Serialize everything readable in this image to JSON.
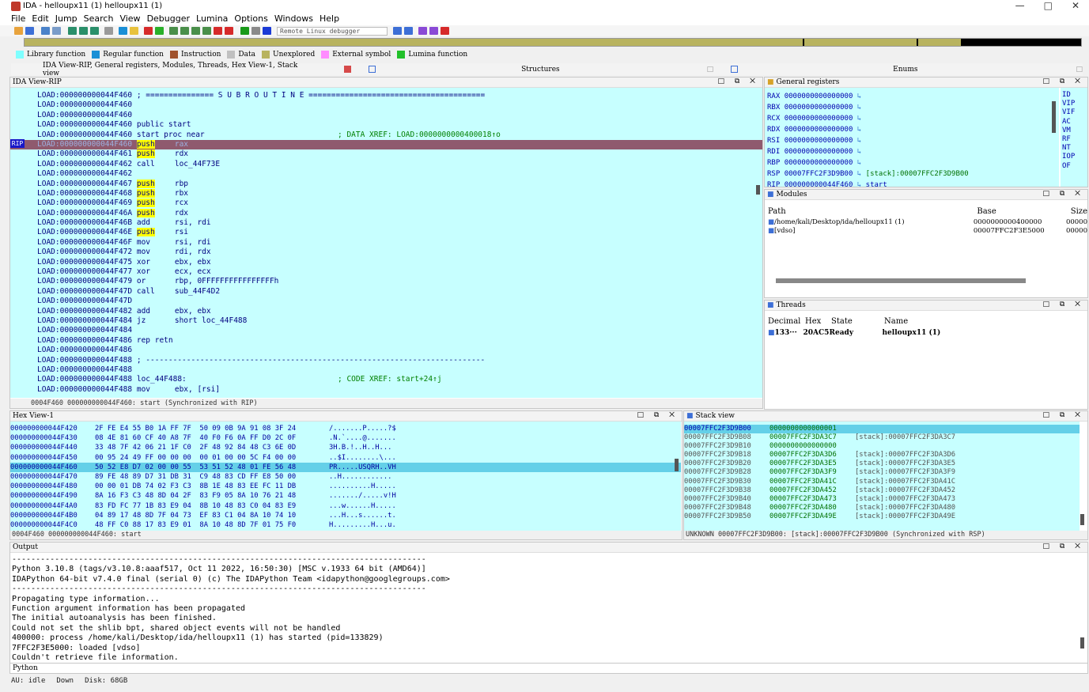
{
  "window": {
    "title": "IDA - helloupx11 (1) helloupx11 (1)",
    "minimize": "—",
    "maximize": "□",
    "close": "✕"
  },
  "menu": [
    "File",
    "Edit",
    "Jump",
    "Search",
    "View",
    "Debugger",
    "Lumina",
    "Options",
    "Windows",
    "Help"
  ],
  "toolbar": {
    "debugger_select": "Remote Linux debugger"
  },
  "legend": [
    {
      "label": "Library function",
      "color": "#7fffff"
    },
    {
      "label": "Regular function",
      "color": "#1a8fd6"
    },
    {
      "label": "Instruction",
      "color": "#a0522d"
    },
    {
      "label": "Data",
      "color": "#c0c0c0"
    },
    {
      "label": "Unexplored",
      "color": "#b8b35f"
    },
    {
      "label": "External symbol",
      "color": "#ff8cff"
    },
    {
      "label": "Lumina function",
      "color": "#22c02a"
    }
  ],
  "tabs": {
    "main": "IDA View-RIP, General registers, Modules, Threads, Hex View-1, Stack view",
    "structures": "Structures",
    "enums": "Enums"
  },
  "ida_view": {
    "title": "IDA View-RIP",
    "rip_label": "RIP",
    "lines": [
      {
        "addr": "LOAD:000000000044F460",
        "text": "; =============== S U B R O U T I N E =======================================",
        "hl": false
      },
      {
        "addr": "LOAD:000000000044F460",
        "text": "",
        "hl": false
      },
      {
        "addr": "LOAD:000000000044F460",
        "text": "",
        "hl": false
      },
      {
        "addr": "LOAD:000000000044F460",
        "text": "public start",
        "hl": false
      },
      {
        "addr": "LOAD:000000000044F460",
        "text": "start proc near",
        "cmt": "; DATA XREF: LOAD:0000000000400018↑o",
        "hl": false
      },
      {
        "addr": "LOAD:000000000044F460",
        "mn": "push",
        "op": "rax",
        "hl": true
      },
      {
        "addr": "LOAD:000000000044F461",
        "mn": "push",
        "op": "rdx",
        "hl": false
      },
      {
        "addr": "LOAD:000000000044F462",
        "mn": "call",
        "op": "loc_44F73E",
        "hl": false
      },
      {
        "addr": "LOAD:000000000044F462",
        "text": "",
        "hl": false
      },
      {
        "addr": "LOAD:000000000044F467",
        "mn": "push",
        "op": "rbp",
        "hl": false
      },
      {
        "addr": "LOAD:000000000044F468",
        "mn": "push",
        "op": "rbx",
        "hl": false
      },
      {
        "addr": "LOAD:000000000044F469",
        "mn": "push",
        "op": "rcx",
        "hl": false
      },
      {
        "addr": "LOAD:000000000044F46A",
        "mn": "push",
        "op": "rdx",
        "hl": false
      },
      {
        "addr": "LOAD:000000000044F46B",
        "mn": "add",
        "op": "rsi, rdi",
        "hl": false
      },
      {
        "addr": "LOAD:000000000044F46E",
        "mn": "push",
        "op": "rsi",
        "hl": false
      },
      {
        "addr": "LOAD:000000000044F46F",
        "mn": "mov",
        "op": "rsi, rdi",
        "hl": false
      },
      {
        "addr": "LOAD:000000000044F472",
        "mn": "mov",
        "op": "rdi, rdx",
        "hl": false
      },
      {
        "addr": "LOAD:000000000044F475",
        "mn": "xor",
        "op": "ebx, ebx",
        "hl": false
      },
      {
        "addr": "LOAD:000000000044F477",
        "mn": "xor",
        "op": "ecx, ecx",
        "hl": false
      },
      {
        "addr": "LOAD:000000000044F479",
        "mn": "or",
        "op": "rbp, 0FFFFFFFFFFFFFFFFh",
        "hl": false
      },
      {
        "addr": "LOAD:000000000044F47D",
        "mn": "call",
        "op": "sub_44F4D2",
        "hl": false
      },
      {
        "addr": "LOAD:000000000044F47D",
        "text": "",
        "hl": false
      },
      {
        "addr": "LOAD:000000000044F482",
        "mn": "add",
        "op": "ebx, ebx",
        "hl": false
      },
      {
        "addr": "LOAD:000000000044F484",
        "mn": "jz",
        "op": "short loc_44F488",
        "hl": false
      },
      {
        "addr": "LOAD:000000000044F484",
        "text": "",
        "hl": false
      },
      {
        "addr": "LOAD:000000000044F486",
        "mn": "rep retn",
        "op": "",
        "hl": false
      },
      {
        "addr": "LOAD:000000000044F486",
        "text": "",
        "hl": false
      },
      {
        "addr": "LOAD:000000000044F488",
        "text": "; ---------------------------------------------------------------------------",
        "hl": false
      },
      {
        "addr": "LOAD:000000000044F488",
        "text": "",
        "hl": false
      },
      {
        "addr": "LOAD:000000000044F488",
        "text": "loc_44F488:",
        "cmt": "; CODE XREF: start+24↑j",
        "hl": false
      },
      {
        "addr": "LOAD:000000000044F488",
        "mn": "mov",
        "op": "ebx, [rsi]",
        "hl": false
      }
    ],
    "status": "0004F460 000000000044F460: start (Synchronized with RIP)"
  },
  "registers": {
    "title": "General registers",
    "rows": [
      {
        "name": "RAX",
        "value": "0000000000000000",
        "extra": ""
      },
      {
        "name": "RBX",
        "value": "0000000000000000",
        "extra": ""
      },
      {
        "name": "RCX",
        "value": "0000000000000000",
        "extra": ""
      },
      {
        "name": "RDX",
        "value": "0000000000000000",
        "extra": ""
      },
      {
        "name": "RSI",
        "value": "0000000000000000",
        "extra": ""
      },
      {
        "name": "RDI",
        "value": "0000000000000000",
        "extra": ""
      },
      {
        "name": "RBP",
        "value": "0000000000000000",
        "extra": ""
      },
      {
        "name": "RSP",
        "value": "00007FFC2F3D9B00",
        "extra": "[stack]:00007FFC2F3D9B00"
      },
      {
        "name": "RIP",
        "value": "000000000044F460",
        "extra": "start"
      }
    ],
    "flags": [
      "ID",
      "VIP",
      "VIF",
      "AC",
      "VM",
      "RF",
      "NT",
      "IOP",
      "OF"
    ]
  },
  "modules": {
    "title": "Modules",
    "headers": [
      "Path",
      "Base",
      "Size"
    ],
    "rows": [
      {
        "path": "/home/kali/Desktop/ida/helloupx11 (1)",
        "base": "0000000000400000",
        "size": "00000"
      },
      {
        "path": "[vdso]",
        "base": "00007FFC2F3E5000",
        "size": "00000"
      }
    ]
  },
  "threads": {
    "title": "Threads",
    "headers": [
      "Decimal",
      "Hex",
      "State",
      "Name"
    ],
    "rows": [
      {
        "decimal": "133···",
        "hex": "20AC5",
        "state": "Ready",
        "name": "helloupx11 (1)"
      }
    ]
  },
  "hex_view": {
    "title": "Hex View-1",
    "rows": [
      {
        "addr": "000000000044F420",
        "bytes": "2F FE E4 55 B0 1A FF 7F  50 09 0B 9A 91 08 3F 24",
        "ascii": "/.......P.....?$",
        "sel": false
      },
      {
        "addr": "000000000044F430",
        "bytes": "08 4E 81 60 CF 40 A8 7F  40 F0 F6 0A FF D0 2C 0F",
        "ascii": ".N.`....@.......",
        "sel": false
      },
      {
        "addr": "000000000044F440",
        "bytes": "33 48 7F 42 06 21 1F C0  2F 48 92 84 48 C3 6E 0D",
        "ascii": "3H.B.!..H..H...",
        "sel": false
      },
      {
        "addr": "000000000044F450",
        "bytes": "00 95 24 49 FF 00 00 00  00 01 00 00 5C F4 00 00",
        "ascii": "..$I........\\...",
        "sel": false
      },
      {
        "addr": "000000000044F460",
        "bytes": "50 52 E8 D7 02 00 00 55  53 51 52 48 01 FE 56 48",
        "ascii": "PR.....USQRH..VH",
        "sel": true
      },
      {
        "addr": "000000000044F470",
        "bytes": "89 FE 48 89 D7 31 DB 31  C9 48 83 CD FF E8 50 00",
        "ascii": "..H............",
        "sel": false
      },
      {
        "addr": "000000000044F480",
        "bytes": "00 00 01 DB 74 02 F3 C3  8B 1E 48 83 EE FC 11 DB",
        "ascii": "..........H.....",
        "sel": false
      },
      {
        "addr": "000000000044F490",
        "bytes": "8A 16 F3 C3 48 8D 04 2F  83 F9 05 8A 10 76 21 48",
        "ascii": "......./.....v!H",
        "sel": false
      },
      {
        "addr": "000000000044F4A0",
        "bytes": "83 FD FC 77 1B 83 E9 04  8B 10 48 83 C0 04 83 E9",
        "ascii": "...w......H.....",
        "sel": false
      },
      {
        "addr": "000000000044F4B0",
        "bytes": "04 89 17 48 8D 7F 04 73  EF 83 C1 04 8A 10 74 10",
        "ascii": "...H...s......t.",
        "sel": false
      },
      {
        "addr": "000000000044F4C0",
        "bytes": "48 FF C0 88 17 83 E9 01  8A 10 48 8D 7F 01 75 F0",
        "ascii": "H.........H...u.",
        "sel": false
      }
    ],
    "status": "0004F460 000000000044F460: start"
  },
  "stack_view": {
    "title": "Stack view",
    "rows": [
      {
        "addr": "00007FFC2F3D9B00",
        "value": "0000000000000001",
        "cmt": "",
        "sel": true
      },
      {
        "addr": "00007FFC2F3D9B08",
        "value": "00007FFC2F3DA3C7",
        "cmt": "[stack]:00007FFC2F3DA3C7",
        "sel": false
      },
      {
        "addr": "00007FFC2F3D9B10",
        "value": "0000000000000000",
        "cmt": "",
        "sel": false
      },
      {
        "addr": "00007FFC2F3D9B18",
        "value": "00007FFC2F3DA3D6",
        "cmt": "[stack]:00007FFC2F3DA3D6",
        "sel": false
      },
      {
        "addr": "00007FFC2F3D9B20",
        "value": "00007FFC2F3DA3E5",
        "cmt": "[stack]:00007FFC2F3DA3E5",
        "sel": false
      },
      {
        "addr": "00007FFC2F3D9B28",
        "value": "00007FFC2F3DA3F9",
        "cmt": "[stack]:00007FFC2F3DA3F9",
        "sel": false
      },
      {
        "addr": "00007FFC2F3D9B30",
        "value": "00007FFC2F3DA41C",
        "cmt": "[stack]:00007FFC2F3DA41C",
        "sel": false
      },
      {
        "addr": "00007FFC2F3D9B38",
        "value": "00007FFC2F3DA452",
        "cmt": "[stack]:00007FFC2F3DA452",
        "sel": false
      },
      {
        "addr": "00007FFC2F3D9B40",
        "value": "00007FFC2F3DA473",
        "cmt": "[stack]:00007FFC2F3DA473",
        "sel": false
      },
      {
        "addr": "00007FFC2F3D9B48",
        "value": "00007FFC2F3DA480",
        "cmt": "[stack]:00007FFC2F3DA480",
        "sel": false
      },
      {
        "addr": "00007FFC2F3D9B50",
        "value": "00007FFC2F3DA49E",
        "cmt": "[stack]:00007FFC2F3DA49E",
        "sel": false
      }
    ],
    "status": "UNKNOWN 00007FFC2F3D9B00: [stack]:00007FFC2F3D9B00 (Synchronized with RSP)"
  },
  "output": {
    "title": "Output",
    "lines": [
      "---------------------------------------------------------------------------------------",
      "Python 3.10.8 (tags/v3.10.8:aaaf517, Oct 11 2022, 16:50:30) [MSC v.1933 64 bit (AMD64)]",
      "IDAPython 64-bit v7.4.0 final (serial 0) (c) The IDAPython Team <idapython@googlegroups.com>",
      "---------------------------------------------------------------------------------------",
      "Propagating type information...",
      "Function argument information has been propagated",
      "The initial autoanalysis has been finished.",
      "Could not set the shlib bpt, shared object events will not be handled",
      "400000: process /home/kali/Desktop/ida/helloupx11 (1) has started (pid=133829)",
      "7FFC2F3E5000: loaded [vdso]",
      "Couldn't retrieve file information."
    ],
    "python_label": "Python"
  },
  "statusbar": {
    "au": "AU:",
    "state": "idle",
    "dir": "Down",
    "disk": "Disk: 68GB"
  }
}
